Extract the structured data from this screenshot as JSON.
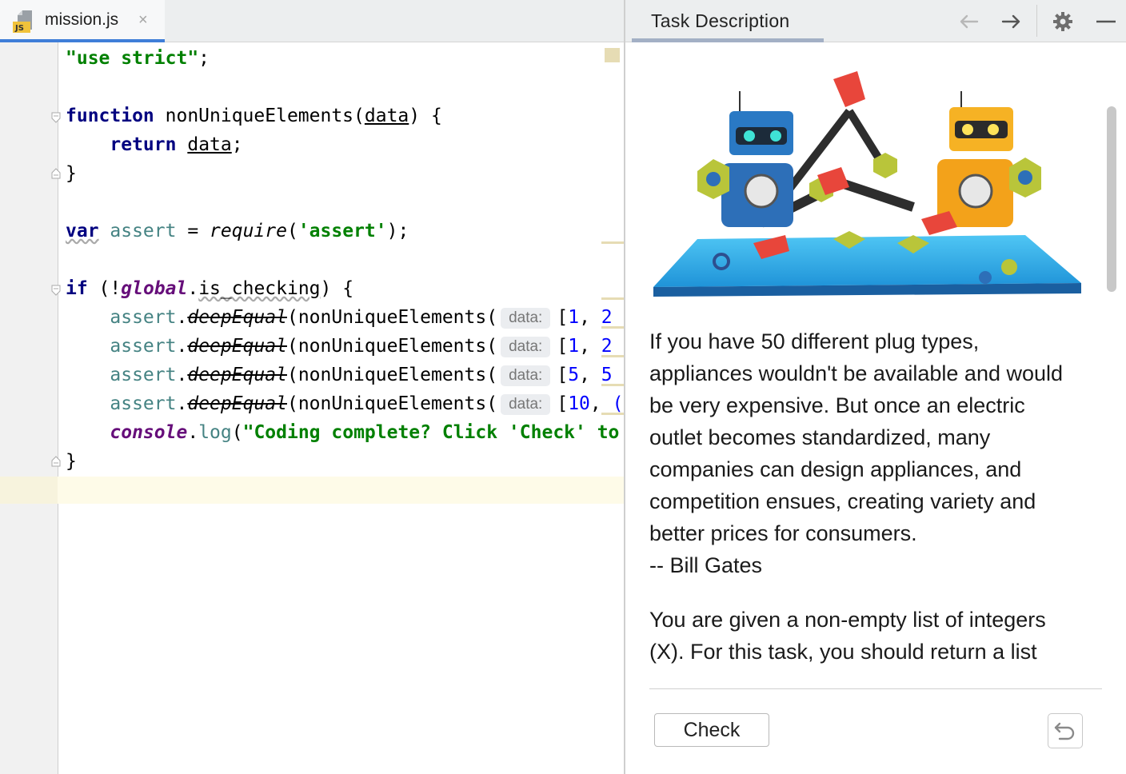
{
  "editor": {
    "tab": {
      "file_name": "mission.js",
      "icon": "js-file-icon",
      "icon_text": "JS",
      "close_symbol": "×"
    },
    "code": {
      "l1_str": "\"use strict\"",
      "l1_semi": ";",
      "l3_kw": "function",
      "l3_name": " nonUniqueElements(",
      "l3_param": "data",
      "l3_end": ") {",
      "l4_indent": "    ",
      "l4_kw": "return",
      "l4_sp": " ",
      "l4_param": "data",
      "l4_semi": ";",
      "l5": "}",
      "l7_kw": "var",
      "l7_var": " assert",
      "l7_eq": " = ",
      "l7_req": "require",
      "l7_open": "(",
      "l7_str": "'assert'",
      "l7_close": ");",
      "l9_kw": "if",
      "l9_open": " (!",
      "l9_glob": "global",
      "l9_dot": ".",
      "l9_prop": "is_checking",
      "l9_end": ") {",
      "assert_indent": "    ",
      "assert_obj": "assert",
      "assert_dot": ".",
      "assert_method": "deepEqual",
      "assert_call": "(nonUniqueElements(",
      "param_hint": "data:",
      "a1_open": "[",
      "a1_num1": "1",
      "a1_sep": ", ",
      "a1_num2": "2",
      "a2_open": "[",
      "a2_num1": "1",
      "a2_sep": ", ",
      "a2_num2": "2",
      "a3_open": "[",
      "a3_num1": "5",
      "a3_sep": ", ",
      "a3_num2": "5",
      "a4_open": "[",
      "a4_num1": "10",
      "a4_sep": ", ",
      "a4_num2": "(",
      "log_obj": "console",
      "log_dot": ".",
      "log_fn": "log",
      "log_open": "(",
      "log_str": "\"Coding complete? Click 'Check' to",
      "l16": "}"
    }
  },
  "task": {
    "header": {
      "title": "Task Description",
      "back_icon": "arrow-left-icon",
      "forward_icon": "arrow-right-icon",
      "settings_icon": "gear-icon",
      "minimize_icon": "minimize-icon"
    },
    "illustration": "two-robots-building-illustration",
    "quote_lines": [
      "If you have 50 different plug types,",
      "appliances wouldn't be available and would",
      "be very expensive. But once an electric",
      "outlet becomes standardized, many",
      "companies can design appliances, and",
      "competition ensues, creating variety and",
      "better prices for consumers.",
      "-- Bill Gates"
    ],
    "description_lines": [
      "You are given a non-empty list of integers",
      "(X). For this task, you should return a list"
    ],
    "check_label": "Check",
    "reset_icon": "undo-icon"
  },
  "colors": {
    "keyword": "#000080",
    "string": "#008000",
    "number": "#0000ff",
    "variable": "#458383",
    "global": "#660e7a",
    "tab_accent": "#3f7ed8"
  }
}
